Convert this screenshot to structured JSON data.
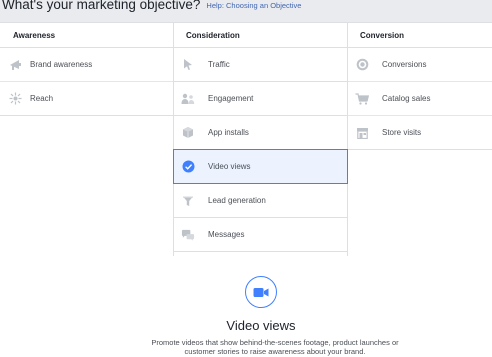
{
  "header": {
    "title": "What's your marketing objective?",
    "help_link": "Help: Choosing an Objective"
  },
  "columns": [
    {
      "heading": "Awareness",
      "items": [
        {
          "label": "Brand awareness",
          "icon": "megaphone-icon"
        },
        {
          "label": "Reach",
          "icon": "reach-burst-icon"
        }
      ]
    },
    {
      "heading": "Consideration",
      "items": [
        {
          "label": "Traffic",
          "icon": "cursor-icon"
        },
        {
          "label": "Engagement",
          "icon": "people-icon"
        },
        {
          "label": "App installs",
          "icon": "box-icon"
        },
        {
          "label": "Video views",
          "icon": "check-circle-icon",
          "selected": true
        },
        {
          "label": "Lead generation",
          "icon": "funnel-icon"
        },
        {
          "label": "Messages",
          "icon": "chat-bubbles-icon"
        }
      ]
    },
    {
      "heading": "Conversion",
      "items": [
        {
          "label": "Conversions",
          "icon": "globe-icon"
        },
        {
          "label": "Catalog sales",
          "icon": "cart-icon"
        },
        {
          "label": "Store visits",
          "icon": "store-icon"
        }
      ]
    }
  ],
  "detail": {
    "icon": "video-camera-icon",
    "title": "Video views",
    "description_line1": "Promote videos that show behind-the-scenes footage, product launches or",
    "description_line2": "customer stories to raise awareness about your brand."
  },
  "colors": {
    "accent": "#4080ff",
    "selected_bg": "#ecf3ff",
    "icon_gray": "#bec2c9",
    "link": "#4267b2"
  }
}
